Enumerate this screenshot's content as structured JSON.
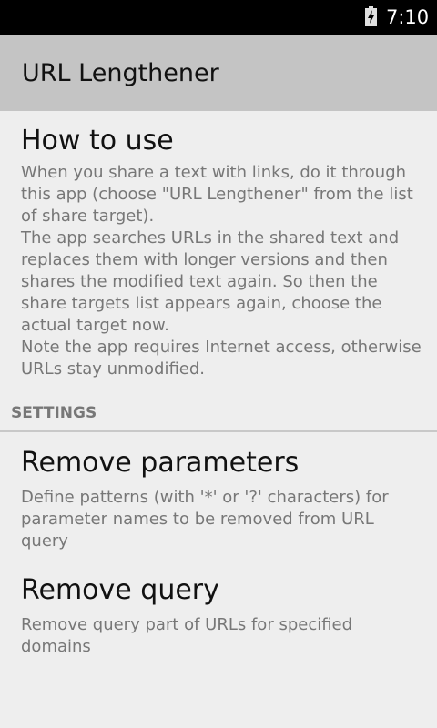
{
  "status_bar": {
    "time": "7:10",
    "battery_icon": "battery-charging-icon"
  },
  "app_bar": {
    "title": "URL Lengthener"
  },
  "how_to_use": {
    "title": "How to use",
    "summary": "When you share a text with links, do it through this app (choose \"URL Lengthener\" from the list of share target).\nThe app searches URLs in the shared text and replaces them with longer versions and then shares the modified text again. So then the share targets list appears again, choose the actual target now.\nNote the app requires Internet access, otherwise URLs stay unmodified."
  },
  "settings": {
    "header": "SETTINGS",
    "items": [
      {
        "title": "Remove parameters",
        "summary": "Define patterns (with '*' or '?' characters) for parameter names to be removed from URL query"
      },
      {
        "title": "Remove query",
        "summary": "Remove query part of URLs for specified domains"
      }
    ]
  },
  "colors": {
    "status_bar": "#000000",
    "action_bar": "#c4c4c4",
    "background": "#eeeeee",
    "title_text": "#111111",
    "summary_text": "#777777"
  }
}
